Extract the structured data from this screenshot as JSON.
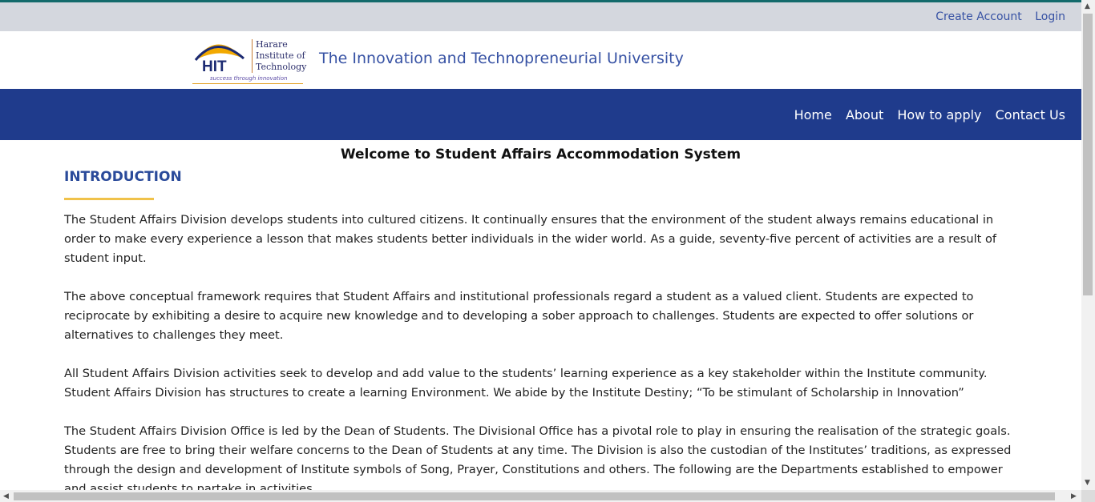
{
  "topbar": {
    "links": [
      "Create Account",
      "Login"
    ]
  },
  "brand": {
    "logo_text_lines": [
      "Harare",
      "Institute of",
      "Technology"
    ],
    "logo_abbrev": "HIT",
    "logo_slogan": "success through innovation",
    "tagline": "The Innovation and Technopreneurial University"
  },
  "nav": {
    "items": [
      "Home",
      "About",
      "How to apply",
      "Contact Us"
    ]
  },
  "main": {
    "welcome": "Welcome to Student Affairs Accommodation System",
    "section_heading": "INTRODUCTION",
    "paragraphs": [
      "The Student Affairs Division develops students into cultured citizens. It continually ensures that the environment of the student always remains educational in order to make every experience a lesson that makes students better individuals in the wider world. As a guide, seventy-five percent of activities are a result of student input.",
      "The above conceptual framework requires that Student Affairs and institutional professionals regard a student as a valued client. Students are expected to reciprocate by exhibiting a desire to acquire new knowledge and to developing a sober approach to challenges. Students are expected to offer solutions or alternatives to challenges they meet.",
      "All Student Affairs Division activities seek to develop and add value to the students’ learning experience as a key stakeholder within the Institute community. Student Affairs Division has structures to create a learning Environment. We abide by the Institute Destiny; “To be stimulant of Scholarship in Innovation”",
      "The Student Affairs Division Office is led by the Dean of Students. The Divisional Office has a pivotal role to play in ensuring the realisation of the strategic goals. Students are free to bring their welfare concerns to the Dean of Students at any time. The Division is also the custodian of the Institutes’ traditions, as expressed through the design and development of Institute symbols of Song, Prayer, Constitutions and others. The following are the Departments established to empower and assist students to partake in activities."
    ]
  },
  "colors": {
    "topbar_bg": "#d4d7de",
    "navbar_bg": "#1f3b8c",
    "link": "#3752a4",
    "accent_underline": "#f0c24a"
  },
  "icons": {
    "logo_arc": "hit-logo-icon",
    "scroll_up": "scroll-up-arrow-icon",
    "scroll_down": "scroll-down-arrow-icon",
    "scroll_left": "scroll-left-arrow-icon",
    "scroll_right": "scroll-right-arrow-icon"
  }
}
